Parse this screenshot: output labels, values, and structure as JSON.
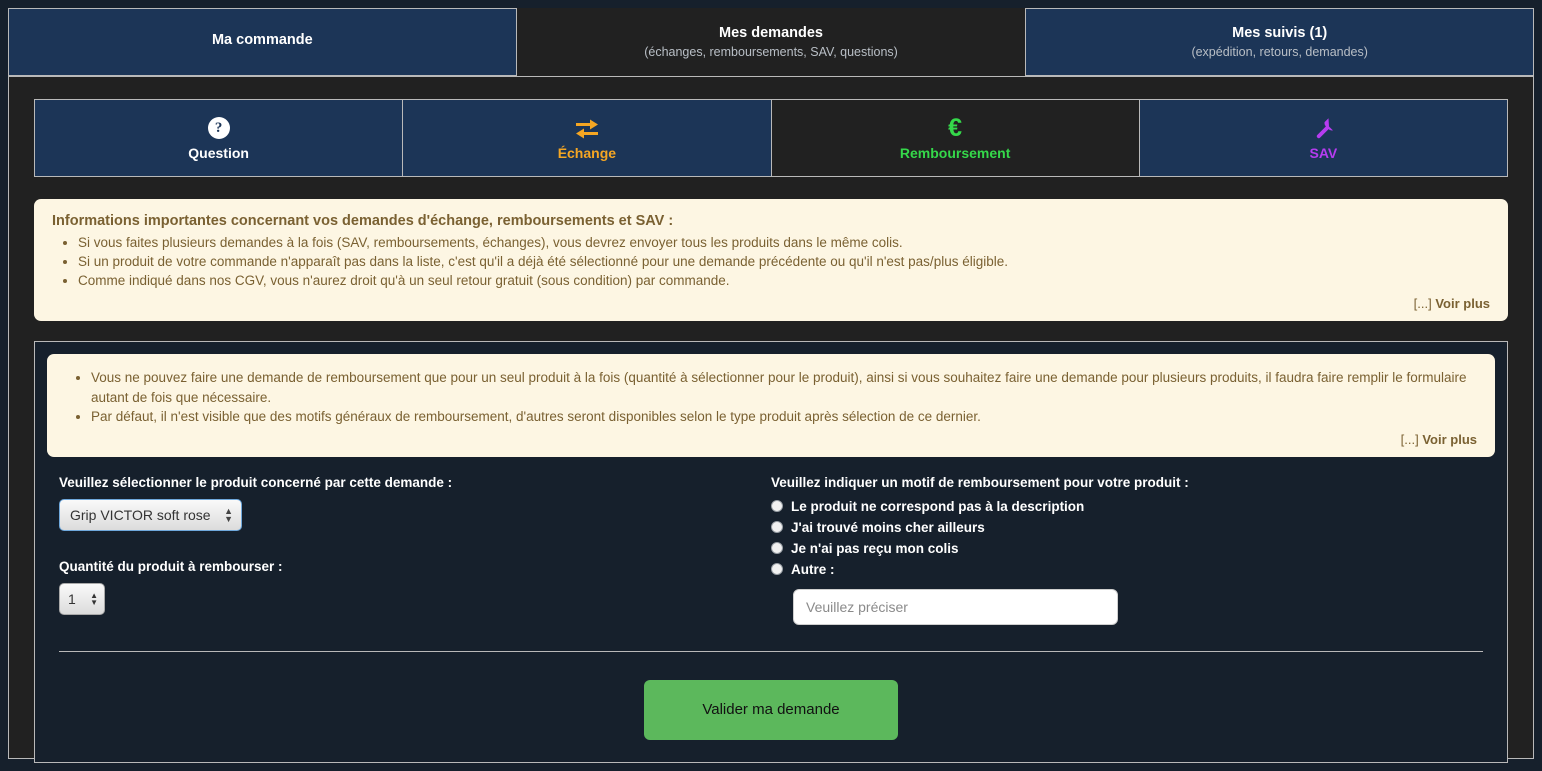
{
  "top_tabs": [
    {
      "title": "Ma commande",
      "subtitle": "",
      "state": "active"
    },
    {
      "title": "Mes demandes",
      "subtitle": "(échanges, remboursements, SAV, questions)",
      "state": "inactive"
    },
    {
      "title": "Mes suivis (1)",
      "subtitle": "(expédition, retours, demandes)",
      "state": "active"
    }
  ],
  "sub_tabs": [
    {
      "label": "Question",
      "icon": "question-circle-icon",
      "color": "#ffffff",
      "bg": "navy"
    },
    {
      "label": "Échange",
      "icon": "exchange-arrows-icon",
      "color": "#f5a623",
      "bg": "navy"
    },
    {
      "label": "Remboursement",
      "icon": "euro-icon",
      "color": "#35d84a",
      "bg": "dark"
    },
    {
      "label": "SAV",
      "icon": "wrench-icon",
      "color": "#b63cf0",
      "bg": "navy"
    }
  ],
  "info_box_general": {
    "title": "Informations importantes concernant vos demandes d'échange, remboursements et SAV :",
    "bullets": [
      "Si vous faites plusieurs demandes à la fois (SAV, remboursements, échanges), vous devrez envoyer tous les produits dans le même colis.",
      "Si un produit de votre commande n'apparaît pas dans la liste, c'est qu'il a déjà été sélectionné pour une demande précédente ou qu'il n'est pas/plus éligible.",
      "Comme indiqué dans nos CGV, vous n'aurez droit qu'à un seul retour gratuit (sous condition) par commande."
    ],
    "ellipsis": "[...]",
    "more_link": "Voir plus"
  },
  "info_box_refund": {
    "bullets": [
      "Vous ne pouvez faire une demande de remboursement que pour un seul produit à la fois (quantité à sélectionner pour le produit), ainsi si vous souhaitez faire une demande pour plusieurs produits, il faudra faire remplir le formulaire autant de fois que nécessaire.",
      "Par défaut, il n'est visible que des motifs généraux de remboursement, d'autres seront disponibles selon le type produit après sélection de ce dernier."
    ],
    "ellipsis": "[...]",
    "more_link": "Voir plus"
  },
  "form": {
    "product_label": "Veuillez sélectionner le produit concerné par cette demande :",
    "product_selected": "Grip VICTOR soft rose",
    "product_options": [
      "Grip VICTOR soft rose"
    ],
    "quantity_label": "Quantité du produit à rembourser :",
    "quantity_value": "1",
    "reason_label": "Veuillez indiquer un motif de remboursement pour votre produit :",
    "reasons": [
      "Le produit ne correspond pas à la description",
      "J'ai trouvé moins cher ailleurs",
      "Je n'ai pas reçu mon colis",
      "Autre :"
    ],
    "other_placeholder": "Veuillez préciser",
    "other_value": "",
    "submit_label": "Valider ma demande"
  },
  "colors": {
    "navy_tab": "#1c3557",
    "panel_dark": "#212121",
    "page_bg": "#16202c",
    "cream": "#fdf6e3",
    "cream_text": "#7a6132",
    "submit_green": "#5cb85c",
    "euro_green": "#35d84a",
    "exchange_orange": "#f5a623",
    "sav_purple": "#b63cf0"
  }
}
